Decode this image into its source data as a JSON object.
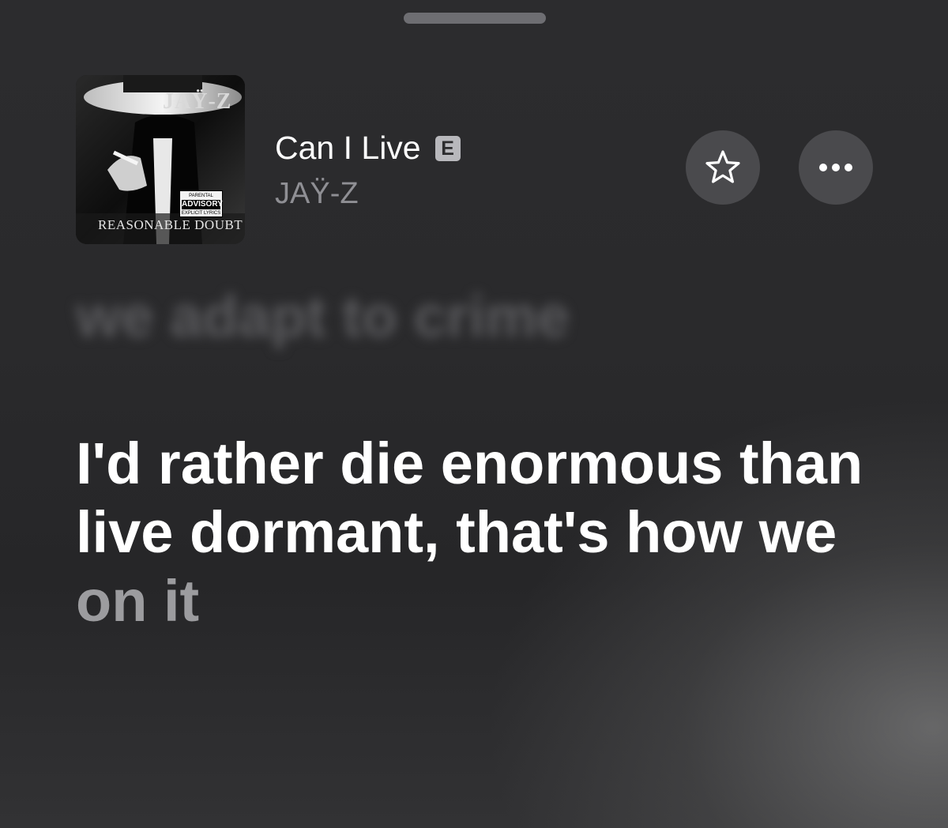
{
  "now_playing": {
    "album_art": {
      "artist_text": "JAŸ-Z",
      "album_text": "REASONABLE DOUBT",
      "advisory_top": "PARENTAL",
      "advisory_main": "ADVISORY",
      "advisory_bottom": "EXPLICIT LYRICS"
    },
    "title": "Can I Live",
    "explicit_badge": "E",
    "artist": "JAŸ-Z"
  },
  "actions": {
    "favorite_icon": "star-icon",
    "more_icon": "ellipsis-icon"
  },
  "lyrics": {
    "previous_line": "we adapt to crime",
    "current_line_sung": "I'd rather die enormous than live dormant, that's how we",
    "current_line_upcoming": "on it"
  },
  "colors": {
    "background": "#2a2a2c",
    "button_bg": "#4a4a4d",
    "artist_text": "#8f8f94",
    "lyric_active": "#ffffff",
    "lyric_upcoming": "#9c9c9f"
  }
}
